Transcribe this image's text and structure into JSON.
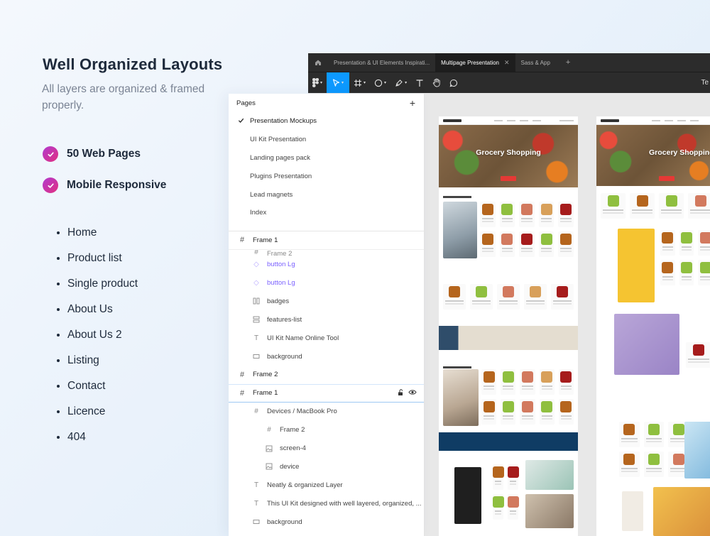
{
  "hero": {
    "title": "Well Organized Layouts",
    "subtitle": "All layers are organized & framed properly."
  },
  "features": [
    {
      "label": "50 Web Pages"
    },
    {
      "label": "Mobile Responsive"
    }
  ],
  "accent_gradient": [
    "#b03ad0",
    "#e2307f"
  ],
  "page_list": [
    "Home",
    "Product list",
    "Single product",
    "About Us",
    "About Us 2",
    "Listing",
    "Contact",
    "Licence",
    "404"
  ],
  "figma": {
    "tabs": [
      {
        "label": "Presentation & UI Elements Inspirati...",
        "active": false
      },
      {
        "label": "Multipage Presentation",
        "active": true
      },
      {
        "label": "Sass & App",
        "active": false
      }
    ],
    "toolbar_right_text": "Te",
    "tool_active_color": "#0d99ff",
    "tools": [
      "figma-menu",
      "move-tool",
      "frame-tool",
      "shape-tool",
      "pen-tool",
      "text-tool",
      "hand-tool",
      "comment-tool"
    ],
    "mockup_hero_text": "Grocery Shopping"
  },
  "layers_panel": {
    "pages_label": "Pages",
    "pages": [
      {
        "label": "Presentation Mockups",
        "selected": true
      },
      {
        "label": "UI Kit Presentation",
        "selected": false
      },
      {
        "label": "Landing pages pack",
        "selected": false
      },
      {
        "label": "Plugins Presentation",
        "selected": false
      },
      {
        "label": "Lead magnets",
        "selected": false
      },
      {
        "label": "Index",
        "selected": false
      }
    ],
    "layers": [
      {
        "label": "Frame 1",
        "icon": "hash-icon",
        "kind": "frame"
      },
      {
        "label": "Frame 2",
        "icon": "hash-icon",
        "kind": "cut"
      },
      {
        "label": "button Lg",
        "icon": "component-icon",
        "kind": "comp"
      },
      {
        "label": "button Lg",
        "icon": "component-icon",
        "kind": "comp"
      },
      {
        "label": "badges",
        "icon": "columns-icon",
        "kind": "normal"
      },
      {
        "label": "features-list",
        "icon": "rows-icon",
        "kind": "normal"
      },
      {
        "label": "UI Kit Name Online Tool",
        "icon": "text-icon",
        "kind": "normal"
      },
      {
        "label": "background",
        "icon": "rectangle-icon",
        "kind": "normal"
      },
      {
        "label": "Frame 2",
        "icon": "hash-icon",
        "kind": "frame"
      },
      {
        "label": "Frame 1",
        "icon": "hash-icon",
        "kind": "frame-selected"
      },
      {
        "label": "Devices / MacBook Pro",
        "icon": "hash-icon",
        "kind": "nested1"
      },
      {
        "label": "Frame 2",
        "icon": "hash-icon",
        "kind": "nested2"
      },
      {
        "label": "screen-4",
        "icon": "image-icon",
        "kind": "nested2"
      },
      {
        "label": "device",
        "icon": "image-icon",
        "kind": "nested2"
      },
      {
        "label": "Neatly & organized Layer",
        "icon": "text-icon",
        "kind": "normal"
      },
      {
        "label": "This UI Kit designed with well layered, organized, ...",
        "icon": "text-icon",
        "kind": "normal"
      },
      {
        "label": "background",
        "icon": "rectangle-icon",
        "kind": "normal"
      }
    ]
  }
}
